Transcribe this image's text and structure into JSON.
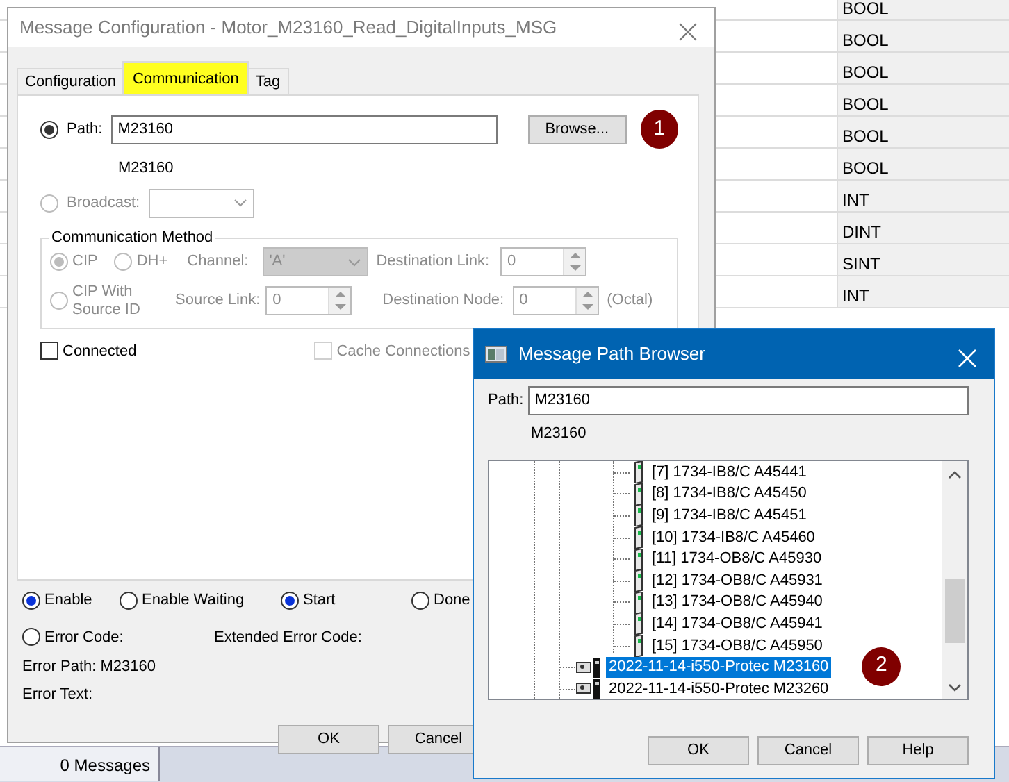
{
  "background_grid": {
    "types": [
      {
        "text": "BOOL"
      },
      {
        "text": "BOOL"
      },
      {
        "text": "BOOL"
      },
      {
        "text": "BOOL"
      },
      {
        "text": "BOOL"
      },
      {
        "text": "BOOL"
      },
      {
        "text": "INT"
      },
      {
        "text": "DINT"
      },
      {
        "text": "SINT"
      },
      {
        "text": "INT"
      }
    ]
  },
  "status_bar": {
    "messages": "0 Messages"
  },
  "config_dialog": {
    "title": "Message Configuration - Motor_M23160_Read_DigitalInputs_MSG",
    "tabs": [
      {
        "label": "Configuration",
        "selected": false,
        "highlighted": false
      },
      {
        "label": "Communication",
        "selected": true,
        "highlighted": true
      },
      {
        "label": "Tag",
        "selected": false,
        "highlighted": false
      }
    ],
    "path": {
      "label": "Path:",
      "checked": true,
      "value": "M23160",
      "resolved": "M23160"
    },
    "browse_button": "Browse...",
    "callout": "1",
    "broadcast": {
      "label": "Broadcast:",
      "checked": false,
      "disabled": true
    },
    "comm_method": {
      "legend": "Communication Method",
      "disabled": true,
      "options": [
        {
          "label": "CIP",
          "checked": true
        },
        {
          "label": "DH+",
          "checked": false
        },
        {
          "label": "CIP With Source ID",
          "checked": false
        }
      ],
      "channel": {
        "label": "Channel:",
        "value": "'A'"
      },
      "destination_link": {
        "label": "Destination Link:",
        "value": "0"
      },
      "source_link": {
        "label": "Source Link:",
        "value": "0"
      },
      "destination_node": {
        "label": "Destination Node:",
        "value": "0"
      },
      "octal": "(Octal)"
    },
    "connected": {
      "label": "Connected",
      "checked": false,
      "disabled": false
    },
    "cache_connections": {
      "label": "Cache Connections",
      "checked": false,
      "disabled": true
    },
    "status": [
      {
        "label": "Enable",
        "checked": true
      },
      {
        "label": "Enable Waiting",
        "checked": false
      },
      {
        "label": "Start",
        "checked": true
      },
      {
        "label": "Done",
        "checked": false
      }
    ],
    "error_code": {
      "label": "Error Code:",
      "checked": false
    },
    "extended_error_code": "Extended Error Code:",
    "error_path": "Error Path: M23160",
    "error_text": "Error Text:",
    "buttons": [
      "OK",
      "Cancel"
    ]
  },
  "path_browser": {
    "title": "Message Path Browser",
    "path_label": "Path:",
    "path_value": "M23160",
    "resolved": "M23160",
    "callout": "2",
    "tree": [
      {
        "label": "[7] 1734-IB8/C A45441",
        "kind": "module",
        "selected": false
      },
      {
        "label": "[8] 1734-IB8/C A45450",
        "kind": "module",
        "selected": false
      },
      {
        "label": "[9] 1734-IB8/C A45451",
        "kind": "module",
        "selected": false
      },
      {
        "label": "[10] 1734-IB8/C A45460",
        "kind": "module",
        "selected": false
      },
      {
        "label": "[11] 1734-OB8/C A45930",
        "kind": "module",
        "selected": false
      },
      {
        "label": "[12] 1734-OB8/C A45931",
        "kind": "module",
        "selected": false
      },
      {
        "label": "[13] 1734-OB8/C A45940",
        "kind": "module",
        "selected": false
      },
      {
        "label": "[14] 1734-OB8/C A45941",
        "kind": "module",
        "selected": false
      },
      {
        "label": "[15] 1734-OB8/C A45950",
        "kind": "module",
        "selected": false
      },
      {
        "label": "2022-11-14-i550-Protec M23160",
        "kind": "device",
        "selected": true
      },
      {
        "label": "2022-11-14-i550-Protec M23260",
        "kind": "device",
        "selected": false
      }
    ],
    "buttons": [
      "OK",
      "Cancel",
      "Help"
    ]
  }
}
